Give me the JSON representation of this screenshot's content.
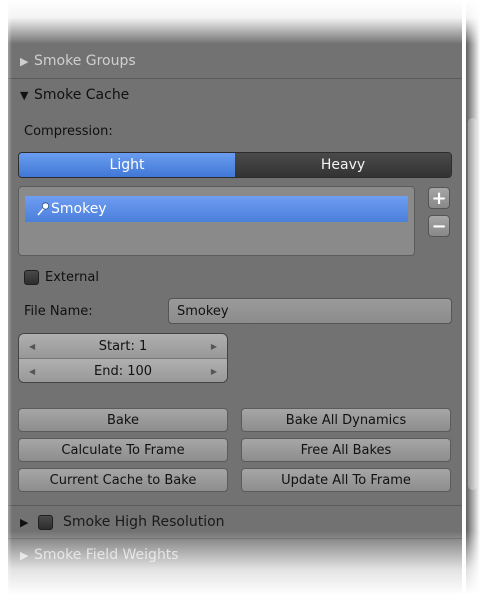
{
  "panels": {
    "smoke_groups": "Smoke Groups",
    "smoke_cache": "Smoke Cache",
    "smoke_high_resolution": "Smoke High Resolution",
    "smoke_field_weights": "Smoke Field Weights"
  },
  "cache": {
    "compression_label": "Compression:",
    "compression_options": [
      "Light",
      "Heavy"
    ],
    "compression_selected": "Light",
    "list_items": [
      "Smokey"
    ],
    "add_symbol": "+",
    "remove_symbol": "−",
    "external_label": "External",
    "external_checked": false,
    "file_name_label": "File Name:",
    "file_name_value": "Smokey",
    "start_label": "Start: 1",
    "end_label": "End: 100",
    "start_value": 1,
    "end_value": 100
  },
  "buttons": {
    "bake": "Bake",
    "bake_all_dynamics": "Bake All Dynamics",
    "calculate_to_frame": "Calculate To Frame",
    "free_all_bakes": "Free All Bakes",
    "current_cache_to_bake": "Current Cache to Bake",
    "update_all_to_frame": "Update All To Frame"
  },
  "high_resolution_checked": false,
  "colors": {
    "panel_bg": "#727272",
    "selected_blue": "#4a7fdb",
    "dark_toggle": "#333333"
  },
  "icons": {
    "collapsed": "triangle-right",
    "expanded": "triangle-down",
    "list_item": "eyedropper-pin"
  }
}
